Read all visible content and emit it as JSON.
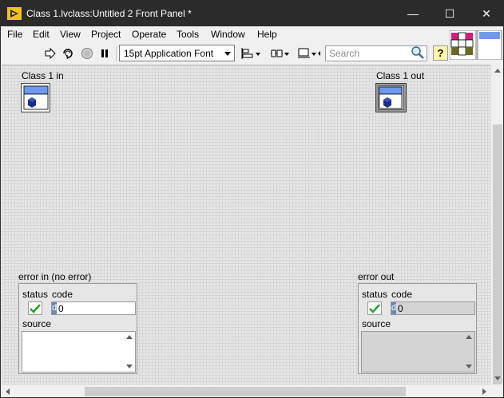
{
  "window": {
    "title": "Class 1.lvclass:Untitled 2 Front Panel *",
    "minimize_glyph": "—",
    "maximize_glyph": "☐",
    "close_glyph": "✕"
  },
  "menu": {
    "items": [
      "File",
      "Edit",
      "View",
      "Project",
      "Operate",
      "Tools",
      "Window",
      "Help"
    ]
  },
  "toolbar": {
    "font_value": "15pt Application Font",
    "search_placeholder": "Search",
    "help_glyph": "?",
    "icons": [
      "run-arrow-icon",
      "run-continuously-icon",
      "abort-icon",
      "pause-icon",
      "align-objects-icon",
      "distribute-objects-icon",
      "resize-objects-icon"
    ]
  },
  "panel": {
    "class_in": {
      "label": "Class 1 in"
    },
    "class_out": {
      "label": "Class 1 out"
    },
    "error_in": {
      "label": "error in (no error)",
      "status_label": "status",
      "code_label": "code",
      "radix": "d",
      "code_value": "0",
      "source_label": "source",
      "source_value": ""
    },
    "error_out": {
      "label": "error out",
      "status_label": "status",
      "code_label": "code",
      "radix": "d",
      "code_value": "0",
      "source_label": "source",
      "source_value": ""
    }
  },
  "colors": {
    "titlebar": "#2b2b2b",
    "status_ok": "#2aa52a",
    "help_bg": "#fff8a8",
    "class_blue": "#6f99f0"
  }
}
